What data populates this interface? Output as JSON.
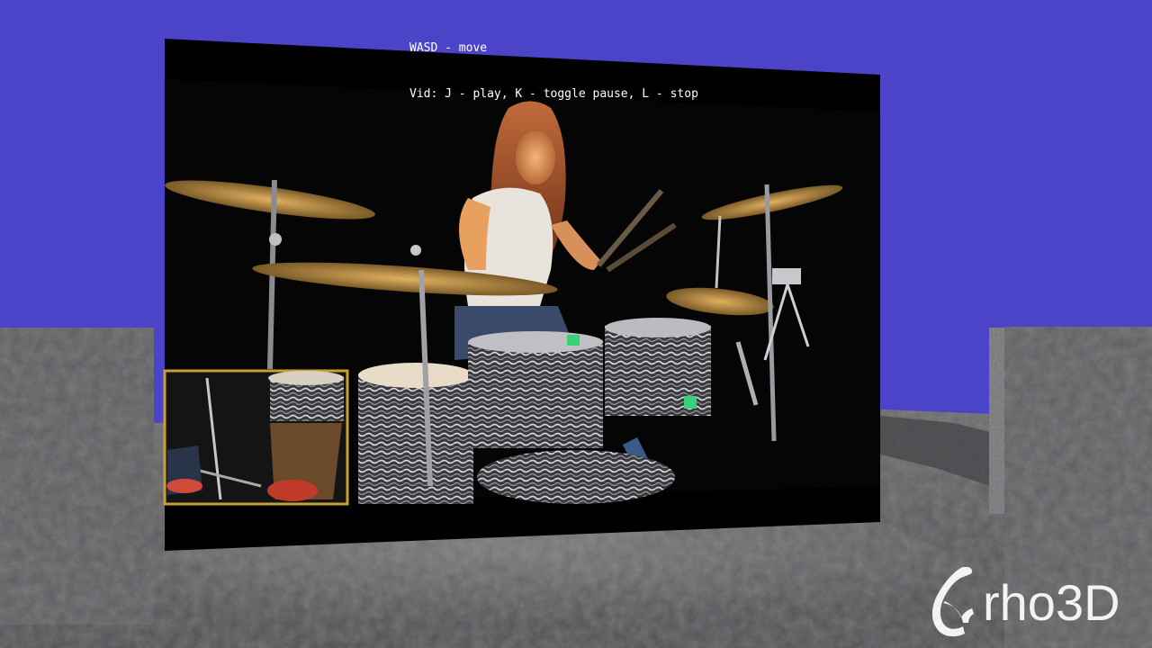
{
  "instructions": {
    "line1": "WASD - move",
    "line2": "Vid: J - play, K - toggle pause, L - stop"
  },
  "logo": {
    "text": "rho3D",
    "icon": "urho-hook-icon"
  },
  "colors": {
    "sky": "#4b44c8",
    "ground": "#57575a",
    "wall": "#5f5f62",
    "screen_frame": "#000000",
    "overlay_text": "#ffffff",
    "inset_border": "#c8a032"
  }
}
